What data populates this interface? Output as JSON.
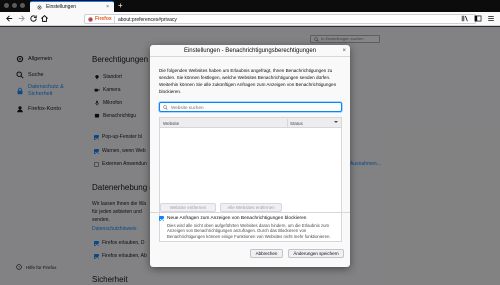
{
  "browser": {
    "tab_title": "Einstellungen",
    "tab_close": "×",
    "new_tab": "+",
    "identity_label": "Firefox",
    "url": "about:preferences#privacy"
  },
  "prefs": {
    "search_placeholder": "In Einstellungen suchen",
    "nav": [
      {
        "label": "Allgemein",
        "icon": "gear-icon"
      },
      {
        "label": "Suche",
        "icon": "search-icon"
      },
      {
        "label_line1": "Datenschutz &",
        "label_line2": "Sicherheit",
        "icon": "lock-icon",
        "active": true
      },
      {
        "label": "Firefox-Konto",
        "icon": "account-icon"
      }
    ],
    "help_label": "Hilfe für Firefox",
    "permissions_heading": "Berechtigungen",
    "permissions": [
      "Standort",
      "Kamera",
      "Mikrofon",
      "Benachrichtigu"
    ],
    "popup_label": "Pop-up-Fenster bl",
    "warn_label": "Warnen, wenn Web",
    "ext_label": "Externen Anwendun",
    "right_link": "Ausnahmen...",
    "data_heading": "Datenerhebung d",
    "data_text1": "Wir lassen Ihnen die Wa",
    "data_text2": "für jeden anbieten und",
    "data_text3": "senden.",
    "data_link": "Datenschutzhinweis",
    "data_cb1": "Firefox erlauben, D",
    "data_cb2": "Firefox erlauben, Ab",
    "security_heading": "Sicherheit"
  },
  "dialog": {
    "title": "Einstellungen - Benachrichtigungsberechtigungen",
    "close": "×",
    "description": "Die folgenden Websites haben um Erlaubnis angefragt, Ihnen Benachrichtigungen zu senden. Sie können festlegen, welche Websites Benachrichtigungen senden dürfen. Weiterhin können Sie alle zukünftigen Anfragen zum Anzeigen von Benachrichtigungen blockieren.",
    "search_placeholder": "Website suchen",
    "col_website": "Website",
    "col_status": "Status",
    "remove_button": "Website entfernen",
    "remove_all_button": "Alle Websites entfernen",
    "block_label": "Neue Anfragen zum Anzeigen von Benachrichtigungen blockieren",
    "block_description": "Dies wird alle nicht oben aufgeführten Websites daran hindern, um die Erlaubnis zum Anzeigen von Benachrichtigungen anzufragen. Durch das Blockieren von Benachrichtigungen können einige Funktionen von Websites nicht mehr funktionieren.",
    "block_checked": true,
    "cancel_button": "Abbrechen",
    "save_button": "Änderungen speichern"
  },
  "colors": {
    "accent": "#0a84ff",
    "chrome_dark": "#0c0c0d",
    "page_bg": "#f9f9fa"
  }
}
